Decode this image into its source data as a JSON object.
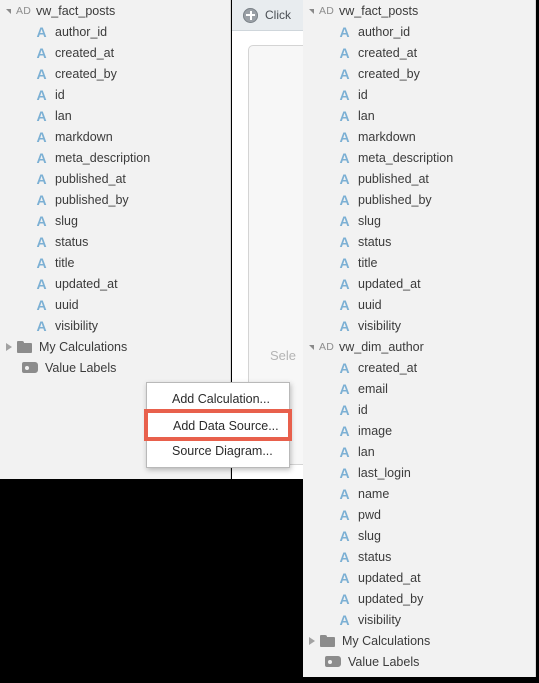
{
  "left_panel": {
    "tree": {
      "root": {
        "tag": "AD",
        "label": "vw_fact_posts",
        "expander": "triangle-down-icon"
      },
      "fields": [
        "author_id",
        "created_at",
        "created_by",
        "id",
        "lan",
        "markdown",
        "meta_description",
        "published_at",
        "published_by",
        "slug",
        "status",
        "title",
        "updated_at",
        "uuid",
        "visibility"
      ],
      "folder": {
        "label": "My Calculations",
        "expander": "triangle-right-icon",
        "icon": "folder-icon"
      },
      "value_labels": {
        "label": "Value Labels",
        "icon": "tag-icon"
      }
    }
  },
  "middle_panel": {
    "toolbar": {
      "icon": "plus-circle-icon",
      "label": "Click"
    },
    "placeholder": "Sele"
  },
  "right_panel": {
    "trees": [
      {
        "root": {
          "tag": "AD",
          "label": "vw_fact_posts",
          "expander": "triangle-down-icon"
        },
        "fields": [
          "author_id",
          "created_at",
          "created_by",
          "id",
          "lan",
          "markdown",
          "meta_description",
          "published_at",
          "published_by",
          "slug",
          "status",
          "title",
          "updated_at",
          "uuid",
          "visibility"
        ]
      },
      {
        "root": {
          "tag": "AD",
          "label": "vw_dim_author",
          "expander": "triangle-down-icon"
        },
        "fields": [
          "created_at",
          "email",
          "id",
          "image",
          "lan",
          "last_login",
          "name",
          "pwd",
          "slug",
          "status",
          "updated_at",
          "updated_by",
          "visibility"
        ]
      }
    ],
    "folder": {
      "label": "My Calculations",
      "expander": "triangle-right-icon",
      "icon": "folder-icon"
    },
    "value_labels": {
      "label": "Value Labels",
      "icon": "tag-icon"
    }
  },
  "context_menu": {
    "items": [
      {
        "label": "Add Calculation...",
        "highlighted": false
      },
      {
        "label": "Add Data Source...",
        "highlighted": true
      },
      {
        "label": "Source Diagram...",
        "highlighted": false
      }
    ]
  },
  "colors": {
    "panel_background": "#f2f2f2",
    "attribute_icon": "#7cb0d4",
    "folder_icon": "#8c8c8c",
    "highlight_border": "#e8604c",
    "text": "#3b3b3b",
    "toolbar_background": "#e8ecef"
  }
}
